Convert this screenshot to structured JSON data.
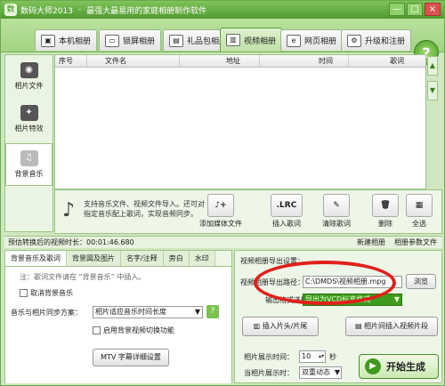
{
  "window": {
    "logo": "数",
    "app": "数码大师2013",
    "tagline": "最强大最易用的家庭相册制作软件",
    "min": "—",
    "max": "□",
    "close": "×"
  },
  "tabs": [
    {
      "label": "本机相册",
      "icon": "▣"
    },
    {
      "label": "锁屏相册",
      "icon": "▭"
    },
    {
      "label": "礼品包相册",
      "icon": "▤"
    },
    {
      "label": "视频相册",
      "icon": "▥"
    },
    {
      "label": "网页相册",
      "icon": "e"
    },
    {
      "label": "升级和注册",
      "icon": "⚙"
    }
  ],
  "help": "?",
  "sidebar": [
    {
      "label": "相片文件",
      "icon": "◉"
    },
    {
      "label": "相片特效",
      "icon": "✦"
    },
    {
      "label": "背景音乐",
      "icon": "♫"
    }
  ],
  "list": {
    "columns": [
      "序号",
      "文件名",
      "地址",
      "时间",
      "歌词"
    ]
  },
  "scroll": {
    "up": "▲",
    "down": "▼"
  },
  "toolbar": {
    "tip": "支持音乐文件、视频文件导入。还可对指定音乐配上歌词，实现音频同步。",
    "buttons": [
      {
        "label": "添加媒体文件",
        "icon": "♪+"
      },
      {
        "label": "插入歌词",
        "icon": ".LRC"
      },
      {
        "label": "清除歌词",
        "icon": "✎"
      },
      {
        "label": "删除",
        "icon": "🗑"
      },
      {
        "label": "全选",
        "icon": "▦"
      }
    ]
  },
  "status": {
    "duration": "预估转换后的视频时长：00:01:46.680",
    "new_album": "新建相册",
    "album_params": "相册参数文件"
  },
  "subtabs": [
    "背景音乐及歌词",
    "背景図及图片",
    "名字/注释",
    "旁白",
    "水印"
  ],
  "music": {
    "hint": "注：歌词文件请在 “背景音乐” 中插入。",
    "cancel_bg": "取消背景音乐",
    "sync_label": "音乐与相片同步方案：",
    "sync_value": "相片适应音乐时间长度",
    "switch_video": "启用背景视频切换功能",
    "mtv_btn": "MTV  字幕详细设置"
  },
  "export": {
    "title": "视频相册导出设置：",
    "path_label": "视频相册导出路径：",
    "path_value": "C:\\DMDS\\视频相册.mpg",
    "browse": "浏览",
    "format_label": "输出格式选择：",
    "format_value": "导出为VCD标准格式",
    "insert_head": "插入片头/片尾",
    "insert_video": "相片间插入视频片段",
    "photo_time_label": "相片展示时间：",
    "photo_time_value": "10",
    "sec": "秒",
    "current_label": "当相片展示时：",
    "current_value": "双重动态"
  },
  "start": {
    "label": "开始生成",
    "icon": "▶"
  }
}
